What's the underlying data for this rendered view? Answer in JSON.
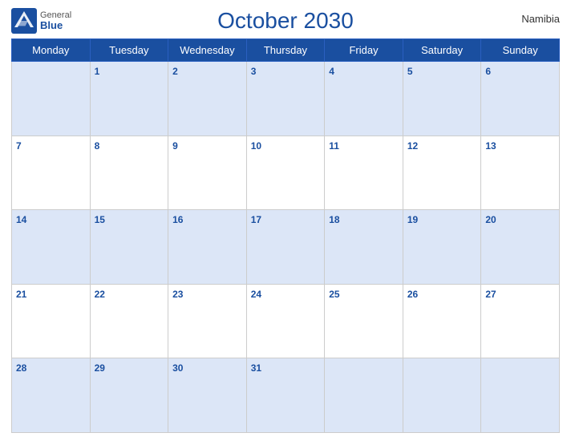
{
  "header": {
    "logo": {
      "general": "General",
      "blue": "Blue"
    },
    "title": "October 2030",
    "country": "Namibia"
  },
  "weekdays": [
    "Monday",
    "Tuesday",
    "Wednesday",
    "Thursday",
    "Friday",
    "Saturday",
    "Sunday"
  ],
  "weeks": [
    [
      {
        "day": "",
        "empty": true
      },
      {
        "day": "1"
      },
      {
        "day": "2"
      },
      {
        "day": "3"
      },
      {
        "day": "4"
      },
      {
        "day": "5"
      },
      {
        "day": "6"
      }
    ],
    [
      {
        "day": "7"
      },
      {
        "day": "8"
      },
      {
        "day": "9"
      },
      {
        "day": "10"
      },
      {
        "day": "11"
      },
      {
        "day": "12"
      },
      {
        "day": "13"
      }
    ],
    [
      {
        "day": "14"
      },
      {
        "day": "15"
      },
      {
        "day": "16"
      },
      {
        "day": "17"
      },
      {
        "day": "18"
      },
      {
        "day": "19"
      },
      {
        "day": "20"
      }
    ],
    [
      {
        "day": "21"
      },
      {
        "day": "22"
      },
      {
        "day": "23"
      },
      {
        "day": "24"
      },
      {
        "day": "25"
      },
      {
        "day": "26"
      },
      {
        "day": "27"
      }
    ],
    [
      {
        "day": "28"
      },
      {
        "day": "29"
      },
      {
        "day": "30"
      },
      {
        "day": "31"
      },
      {
        "day": ""
      },
      {
        "day": ""
      },
      {
        "day": ""
      }
    ]
  ]
}
